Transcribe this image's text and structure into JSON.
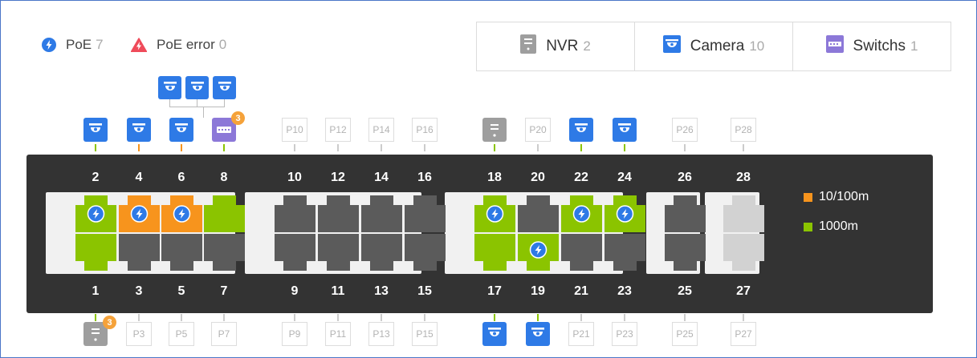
{
  "status": {
    "poe_label": "PoE",
    "poe_count": "7",
    "poe_error_label": "PoE error",
    "poe_error_count": "0",
    "icons": {
      "poe": "lightning-circle-icon",
      "poe_error": "lightning-triangle-icon"
    }
  },
  "tabs": [
    {
      "label": "NVR",
      "count": "2",
      "icon": "nvr-icon"
    },
    {
      "label": "Camera",
      "count": "10",
      "icon": "camera-icon"
    },
    {
      "label": "Switchs",
      "count": "1",
      "icon": "switch-icon"
    }
  ],
  "legend": [
    {
      "label": "10/100m",
      "color": "#f7941d"
    },
    {
      "label": "1000m",
      "color": "#8bc400"
    }
  ],
  "colors": {
    "gigabit": "#8bc400",
    "fast": "#f7941d",
    "idle": "#5b5b5b",
    "disabled": "#d2d2d2",
    "camera": "#2e7ae6",
    "nvr": "#9e9e9e",
    "switch": "#8c78d8",
    "badge": "#f5a23a"
  },
  "ports": {
    "top_labels": [
      "2",
      "4",
      "6",
      "8",
      "10",
      "12",
      "14",
      "16",
      "18",
      "20",
      "22",
      "24",
      "26",
      "28"
    ],
    "bottom_labels": [
      "1",
      "3",
      "5",
      "7",
      "9",
      "11",
      "13",
      "15",
      "17",
      "19",
      "21",
      "23",
      "25",
      "27"
    ],
    "top_state": [
      "gigabit",
      "fast",
      "fast",
      "gigabit",
      "idle",
      "idle",
      "idle",
      "idle",
      "gigabit",
      "idle",
      "gigabit",
      "gigabit",
      "idle",
      "disabled"
    ],
    "top_poe": [
      true,
      true,
      true,
      false,
      false,
      false,
      false,
      false,
      true,
      false,
      true,
      true,
      false,
      false
    ],
    "bottom_state": [
      "gigabit",
      "idle",
      "idle",
      "idle",
      "idle",
      "idle",
      "idle",
      "idle",
      "gigabit",
      "gigabit",
      "idle",
      "idle",
      "idle",
      "disabled"
    ],
    "bottom_poe": [
      false,
      false,
      false,
      false,
      false,
      false,
      false,
      false,
      false,
      true,
      false,
      false,
      false,
      false
    ]
  },
  "devices_top": [
    {
      "type": "camera"
    },
    {
      "type": "camera"
    },
    {
      "type": "camera"
    },
    {
      "type": "switch",
      "badge": "3"
    },
    {
      "placeholder": "P10"
    },
    {
      "placeholder": "P12"
    },
    {
      "placeholder": "P14"
    },
    {
      "placeholder": "P16"
    },
    {
      "type": "nvr"
    },
    {
      "placeholder": "P20"
    },
    {
      "type": "camera"
    },
    {
      "type": "camera"
    },
    {
      "placeholder": "P26"
    },
    {
      "placeholder": "P28"
    }
  ],
  "devices_bottom": [
    {
      "type": "nvr",
      "badge": "3"
    },
    {
      "placeholder": "P3"
    },
    {
      "placeholder": "P5"
    },
    {
      "placeholder": "P7"
    },
    {
      "placeholder": "P9"
    },
    {
      "placeholder": "P11"
    },
    {
      "placeholder": "P13"
    },
    {
      "placeholder": "P15"
    },
    {
      "type": "camera"
    },
    {
      "type": "camera"
    },
    {
      "placeholder": "P21"
    },
    {
      "placeholder": "P23"
    },
    {
      "placeholder": "P25"
    },
    {
      "placeholder": "P27"
    }
  ],
  "cascade_devices": [
    {
      "type": "camera"
    },
    {
      "type": "camera"
    },
    {
      "type": "camera"
    }
  ]
}
